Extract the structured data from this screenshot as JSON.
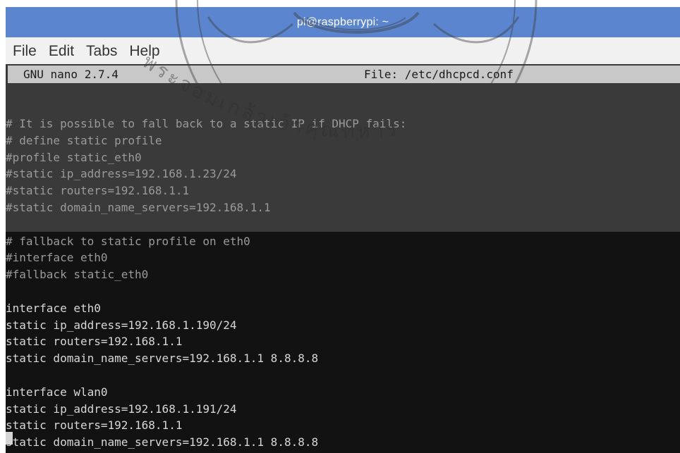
{
  "window": {
    "title": "pi@raspberrypi: ~"
  },
  "menu": {
    "items": [
      "File",
      "Edit",
      "Tabs",
      "Help"
    ]
  },
  "nano": {
    "version": "GNU nano 2.7.4",
    "file": "File: /etc/dhcpcd.conf"
  },
  "editor": {
    "lines": [
      "# It is possible to fall back to a static IP if DHCP fails:",
      "# define static profile",
      "#profile static_eth0",
      "#static ip_address=192.168.1.23/24",
      "#static routers=192.168.1.1",
      "#static domain_name_servers=192.168.1.1",
      "",
      "# fallback to static profile on eth0",
      "#interface eth0",
      "#fallback static_eth0",
      "",
      "interface eth0",
      "static ip_address=192.168.1.190/24",
      "static routers=192.168.1.1",
      "static domain_name_servers=192.168.1.1 8.8.8.8",
      "",
      "interface wlan0",
      "static ip_address=192.168.1.191/24",
      "static routers=192.168.1.1",
      "static domain_name_servers=192.168.1.1 8.8.8.8"
    ]
  },
  "watermark": {
    "text": "พระจอมเกล้าเจ้าคุณทหาร"
  },
  "colors": {
    "titlebar": "#5b86cf",
    "menubar": "#f1f1f1",
    "terminal": "#121212",
    "nano_header": "#c8c8c8"
  }
}
